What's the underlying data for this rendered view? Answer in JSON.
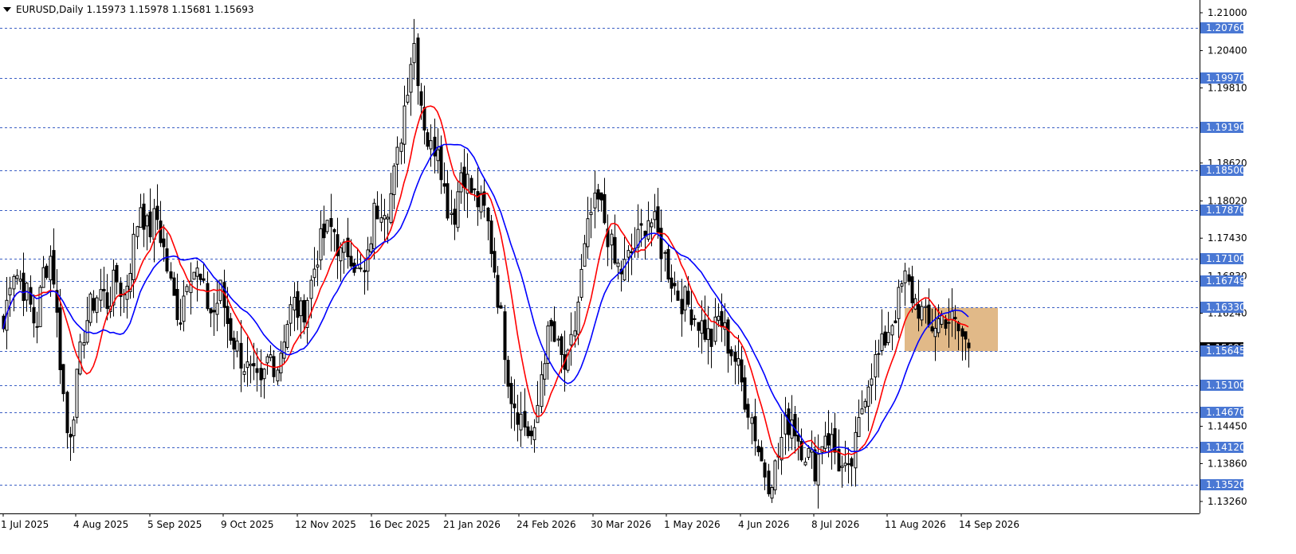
{
  "header": {
    "symbol": "EURUSD,Daily",
    "ohlc": "1.15973 1.15978 1.15681 1.15693"
  },
  "colors": {
    "background": "#ffffff",
    "candle": "#000000",
    "ma_fast": "#ff0000",
    "ma_slow": "#0000ff",
    "level_line": "#3b5fc4",
    "level_label_bg": "#4a78d4",
    "current_label_bg": "#000000",
    "zone_fill": "#d9a86a"
  },
  "chart_data": {
    "type": "candlestick",
    "symbol": "EURUSD",
    "timeframe": "Daily",
    "ylim": [
      1.129,
      1.212
    ],
    "y_ticks": [
      "1.21000",
      "1.20400",
      "1.19810",
      "1.18620",
      "1.18020",
      "1.17430",
      "1.16830",
      "1.16240",
      "1.13860",
      "1.13260",
      "1.14450"
    ],
    "x_ticks": [
      "1 Jul 2025",
      "4 Aug 2025",
      "5 Sep 2025",
      "9 Oct 2025",
      "12 Nov 2025",
      "16 Dec 2025",
      "21 Jan 2026",
      "24 Feb 2026",
      "30 Mar 2026",
      "1 May 2026",
      "4 Jun 2026",
      "8 Jul 2026",
      "11 Aug 2026",
      "14 Sep 2026"
    ],
    "levels": [
      "1.20760",
      "1.19970",
      "1.19190",
      "1.18500",
      "1.17870",
      "1.17100",
      "1.16749",
      "1.16330",
      "1.15645",
      "1.15100",
      "1.14670",
      "1.14120",
      "1.13520"
    ],
    "current_price": "1.15693",
    "current_price_label": "1.15693",
    "zone": {
      "start": "11 Aug 2026",
      "end": "28 Sep 2026",
      "high": 1.1633,
      "low": 1.1564
    },
    "path": [
      1.16,
      1.17,
      1.168,
      1.165,
      1.16,
      1.169,
      1.172,
      1.156,
      1.142,
      1.15,
      1.16,
      1.164,
      1.166,
      1.164,
      1.168,
      1.165,
      1.172,
      1.18,
      1.175,
      1.178,
      1.172,
      1.165,
      1.162,
      1.17,
      1.169,
      1.165,
      1.162,
      1.166,
      1.16,
      1.157,
      1.154,
      1.152,
      1.15,
      1.156,
      1.154,
      1.16,
      1.164,
      1.162,
      1.166,
      1.172,
      1.175,
      1.176,
      1.171,
      1.173,
      1.169,
      1.168,
      1.178,
      1.18,
      1.18,
      1.187,
      1.197,
      1.206,
      1.195,
      1.188,
      1.19,
      1.18,
      1.178,
      1.186,
      1.182,
      1.18,
      1.178,
      1.17,
      1.16,
      1.15,
      1.147,
      1.144,
      1.142,
      1.155,
      1.16,
      1.156,
      1.153,
      1.16,
      1.17,
      1.178,
      1.18,
      1.176,
      1.17,
      1.169,
      1.172,
      1.174,
      1.178,
      1.176,
      1.172,
      1.168,
      1.165,
      1.164,
      1.162,
      1.16,
      1.158,
      1.162,
      1.158,
      1.155,
      1.15,
      1.146,
      1.14,
      1.136,
      1.138,
      1.144,
      1.146,
      1.142,
      1.14,
      1.138,
      1.144,
      1.142,
      1.138,
      1.136,
      1.142,
      1.15,
      1.154,
      1.156,
      1.16,
      1.163,
      1.168,
      1.165,
      1.163,
      1.16,
      1.161,
      1.162,
      1.161,
      1.159,
      1.1569
    ],
    "series": [
      {
        "kind": "moving-average",
        "color": "#ff0000",
        "period": 10
      },
      {
        "kind": "moving-average",
        "color": "#0000ff",
        "period": 20
      }
    ],
    "grid": false,
    "legend": "none"
  }
}
